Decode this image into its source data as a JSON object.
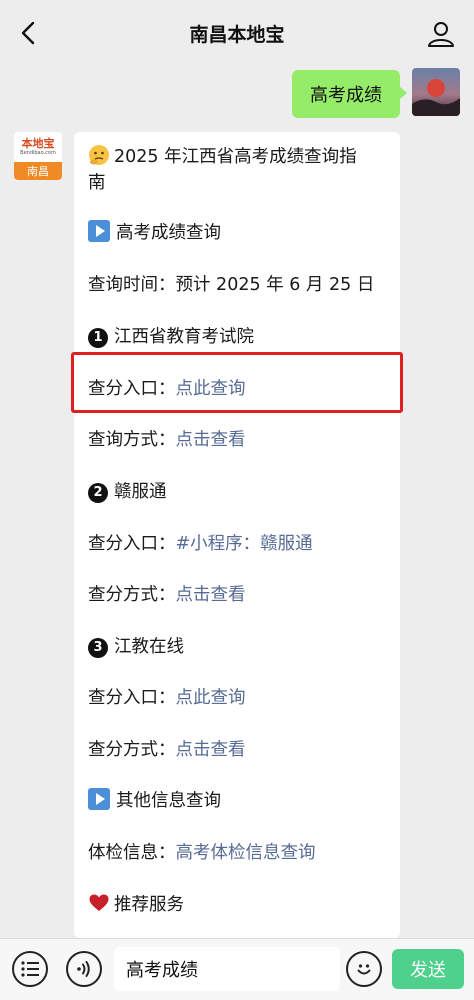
{
  "header": {
    "title": "南昌本地宝"
  },
  "user_message": {
    "text": "高考成绩"
  },
  "bot": {
    "avatar_brand": "本地宝",
    "avatar_site": "Bendibao.com",
    "avatar_city": "南昌"
  },
  "reply": {
    "title_line1": "2025 年江西省高考成绩查询指",
    "title_line2": "南",
    "section1": "高考成绩查询",
    "query_time": "查询时间：预计 2025 年 6 月 25 日",
    "item1": {
      "num": "1",
      "name": "江西省教育考试院",
      "entry_label": "查分入口：",
      "entry_link": "点此查询",
      "method_label": "查询方式：",
      "method_link": "点击查看"
    },
    "item2": {
      "num": "2",
      "name": "赣服通",
      "entry_label": "查分入口：",
      "entry_link": "#小程序：赣服通",
      "method_label": "查分方式：",
      "method_link": "点击查看"
    },
    "item3": {
      "num": "3",
      "name": "江教在线",
      "entry_label": "查分入口：",
      "entry_link": "点此查询",
      "method_label": "查分方式：",
      "method_link": "点击查看"
    },
    "section2": "其他信息查询",
    "physical_label": "体检信息：",
    "physical_link": "高考体检信息查询",
    "section3": "推荐服务"
  },
  "bottombar": {
    "input_value": "高考成绩",
    "send_label": "发送"
  },
  "colors": {
    "link": "#576b95",
    "bubble_green": "#95ec69",
    "send_button": "#07c160",
    "highlight_frame": "#e02020"
  }
}
